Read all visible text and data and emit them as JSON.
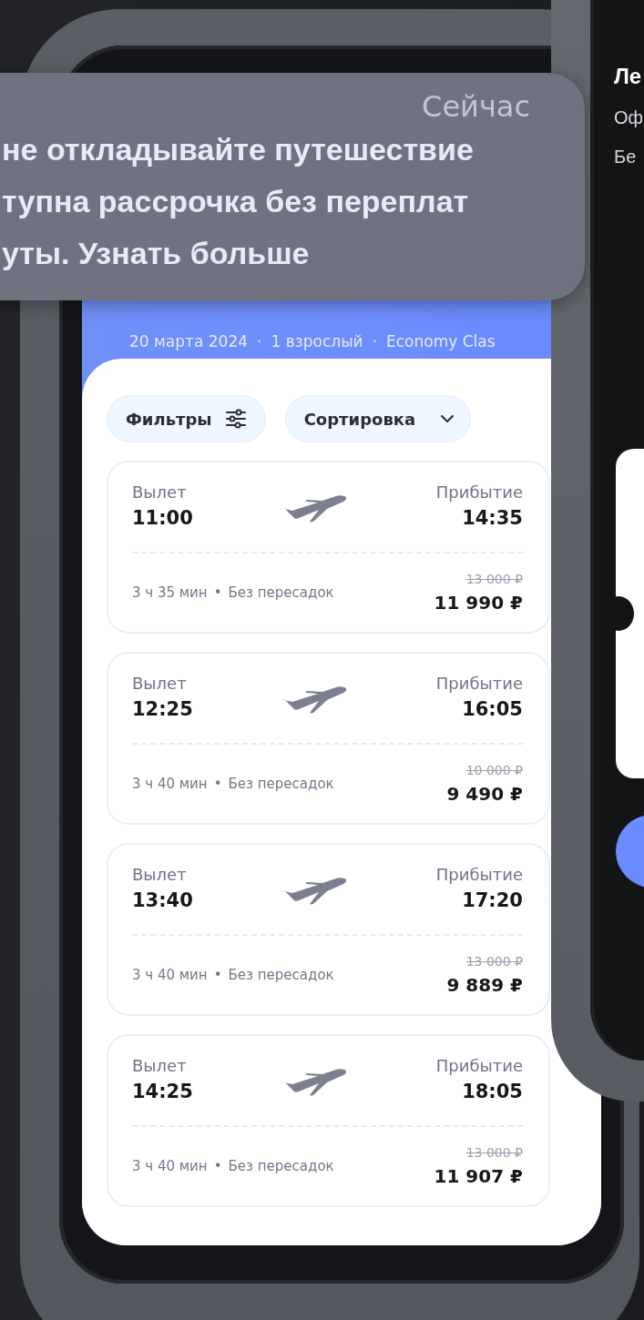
{
  "notification": {
    "time": "Сейчас",
    "lines": [
      "не откладывайте путешествие",
      "тупна рассрочка без переплат",
      "уты. Узнать больше"
    ]
  },
  "search_summary": {
    "separator": "·",
    "details": [
      "20 марта 2024",
      "1 взрослый",
      "Economy Clas"
    ]
  },
  "toolbar": {
    "buttons": [
      {
        "label": "Фильтры",
        "kind": "filter"
      },
      {
        "label": "Сортировка",
        "kind": "sort"
      }
    ]
  },
  "flights": [
    {
      "departure_label": "Вылет",
      "departure_time": "11:00",
      "arrival_label": "Прибытие",
      "arrival_time": "14:35",
      "duration": "3 ч 35 мин",
      "separator": "•",
      "stops": "Без пересадок",
      "old_price": "13 000 ₽",
      "price": "11 990 ₽"
    },
    {
      "departure_label": "Вылет",
      "departure_time": "12:25",
      "arrival_label": "Прибытие",
      "arrival_time": "16:05",
      "duration": "3 ч 40 мин",
      "separator": "•",
      "stops": "Без пересадок",
      "old_price": "10 000 ₽",
      "price": "9 490 ₽"
    },
    {
      "departure_label": "Вылет",
      "departure_time": "13:40",
      "arrival_label": "Прибытие",
      "arrival_time": "17:20",
      "duration": "3 ч 40 мин",
      "separator": "•",
      "stops": "Без пересадок",
      "old_price": "13 000 ₽",
      "price": "9 889 ₽"
    },
    {
      "departure_label": "Вылет",
      "departure_time": "14:25",
      "arrival_label": "Прибытие",
      "arrival_time": "18:05",
      "duration": "3 ч 40 мин",
      "separator": "•",
      "stops": "Без пересадок",
      "old_price": "13 000 ₽",
      "price": "11 907 ₽"
    }
  ],
  "second_screen": {
    "title": "Ле",
    "lines": [
      "Оф",
      "Бе"
    ]
  }
}
